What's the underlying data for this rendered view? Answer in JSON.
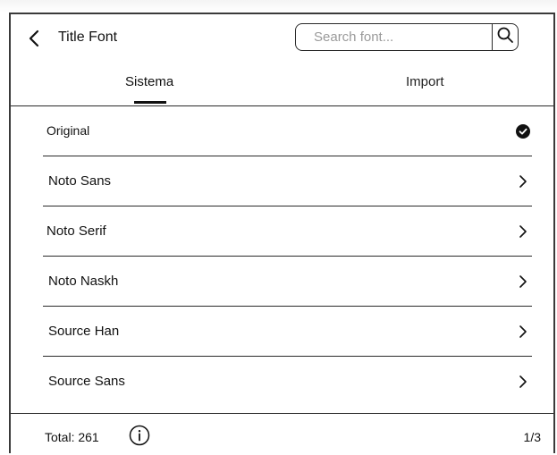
{
  "header": {
    "back_icon": "chevron-left-icon",
    "title": "Title Font",
    "search_placeholder": "Search font...",
    "search_icon": "search-icon"
  },
  "tabs": [
    {
      "label": "Sistema",
      "selected": true
    },
    {
      "label": "Import",
      "selected": false
    }
  ],
  "fonts": [
    {
      "label": "Original",
      "selected": true,
      "icon": "check-circle-icon"
    },
    {
      "label": "Noto Sans",
      "icon": "chevron-right-icon"
    },
    {
      "label": "Noto Serif",
      "icon": "chevron-right-icon"
    },
    {
      "label": "Noto Naskh",
      "icon": "chevron-right-icon"
    },
    {
      "label": "Source Han",
      "icon": "chevron-right-icon"
    },
    {
      "label": "Source Sans",
      "icon": "chevron-right-icon"
    }
  ],
  "footer": {
    "total": "Total: 261",
    "info_icon": "info-icon",
    "page": "1/3"
  }
}
